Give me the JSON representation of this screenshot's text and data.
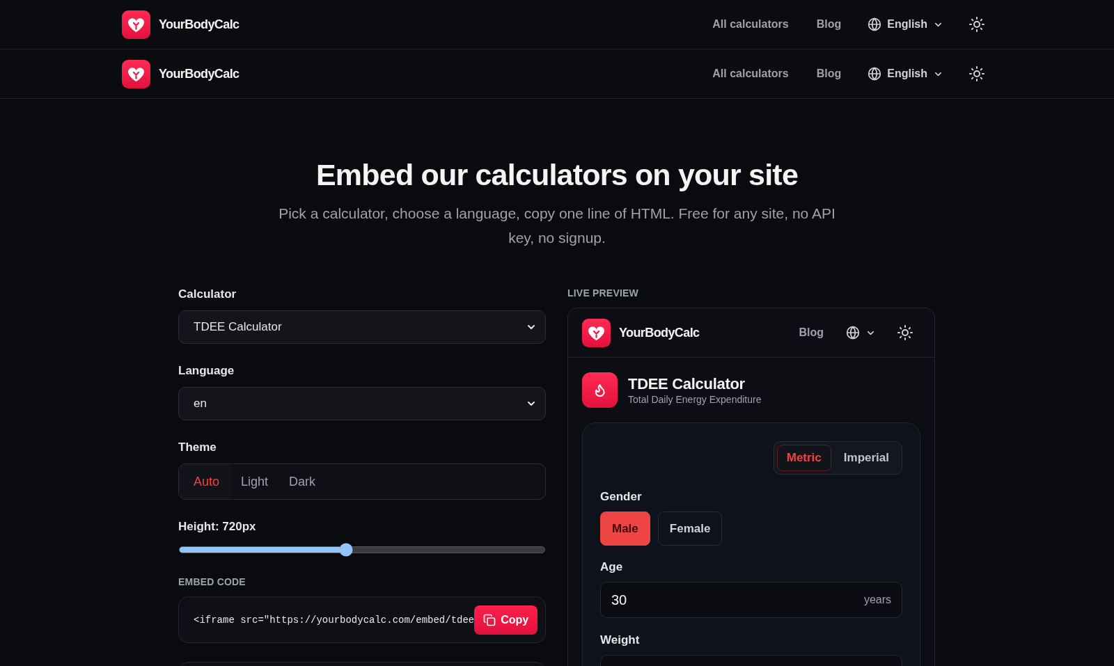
{
  "site_headers": [
    {
      "brand": "YourBodyCalc",
      "nav": [
        "All calculators",
        "Blog"
      ],
      "language": "English"
    },
    {
      "brand": "YourBodyCalc",
      "nav": [
        "All calculators",
        "Blog"
      ],
      "language": "English"
    }
  ],
  "hero": {
    "title": "Embed our calculators on your site",
    "subtitle": "Pick a calculator, choose a language, copy one line of HTML. Free for any site, no API key, no signup."
  },
  "form": {
    "calculator": {
      "label": "Calculator",
      "value": "TDEE Calculator"
    },
    "language": {
      "label": "Language",
      "value": "en"
    },
    "theme": {
      "label": "Theme",
      "options": [
        {
          "label": "Auto",
          "selected": true
        },
        {
          "label": "Light",
          "selected": false
        },
        {
          "label": "Dark",
          "selected": false
        }
      ]
    },
    "height": {
      "label": "Height: 720px",
      "level": 0.457
    },
    "embed_code": {
      "label": "EMBED CODE",
      "code": "<iframe src=\"https://yourbodycalc.com/embed/tdee",
      "copy_button": "Copy"
    }
  },
  "preview": {
    "label": "LIVE PREVIEW",
    "header": {
      "brand": "YourBodyCalc",
      "nav": [
        "Blog"
      ]
    },
    "calculator": {
      "title": "TDEE Calculator",
      "subtitle": "Total Daily Energy Expenditure"
    },
    "units": [
      {
        "label": "Metric",
        "selected": true
      },
      {
        "label": "Imperial",
        "selected": false
      }
    ],
    "gender": {
      "label": "Gender",
      "options": [
        {
          "label": "Male",
          "selected": true
        },
        {
          "label": "Female",
          "selected": false
        }
      ]
    },
    "age": {
      "label": "Age",
      "value": "30",
      "unit": "years"
    },
    "weight": {
      "label": "Weight"
    }
  }
}
